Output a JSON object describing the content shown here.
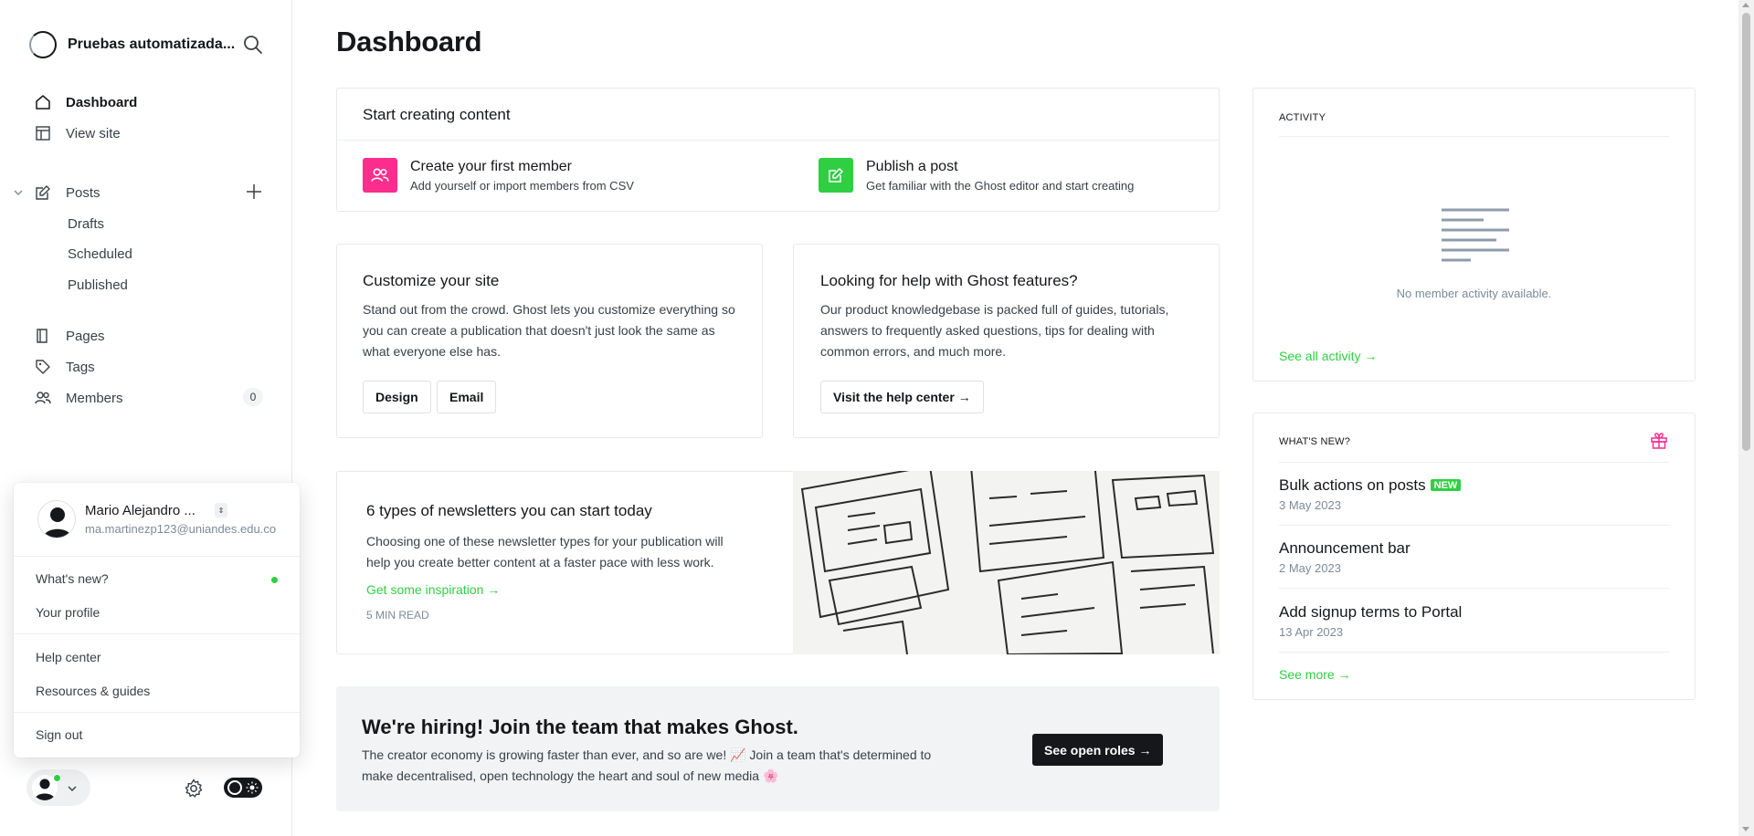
{
  "sidebar": {
    "site_title": "Pruebas automatizada...",
    "nav": {
      "dashboard": "Dashboard",
      "view_site": "View site",
      "posts": "Posts",
      "drafts": "Drafts",
      "scheduled": "Scheduled",
      "published": "Published",
      "pages": "Pages",
      "tags": "Tags",
      "members": "Members",
      "members_count": "0"
    },
    "user_menu": {
      "name": "Mario Alejandro ...",
      "email": "ma.martinezp123@uniandes.edu.co",
      "whats_new": "What's new?",
      "your_profile": "Your profile",
      "help_center": "Help center",
      "resources": "Resources & guides",
      "sign_out": "Sign out"
    }
  },
  "main": {
    "title": "Dashboard",
    "start_creating": {
      "title": "Start creating content",
      "member_title": "Create your first member",
      "member_text": "Add yourself or import members from CSV",
      "post_title": "Publish a post",
      "post_text": "Get familiar with the Ghost editor and start creating"
    },
    "customize": {
      "title": "Customize your site",
      "text": "Stand out from the crowd. Ghost lets you customize everything so you can create a publication that doesn't just look the same as what everyone else has.",
      "design_btn": "Design",
      "email_btn": "Email"
    },
    "help": {
      "title": "Looking for help with Ghost features?",
      "text": "Our product knowledgebase is packed full of guides, tutorials, answers to frequently asked questions, tips for dealing with common errors, and much more.",
      "button": "Visit the help center →"
    },
    "newsletter": {
      "title": "6 types of newsletters you can start today",
      "text": "Choosing one of these newsletter types for your publication will help you create better content at a faster pace with less work.",
      "link": "Get some inspiration →",
      "read_time": "5 MIN READ"
    },
    "hiring": {
      "title": "We're hiring! Join the team that makes Ghost.",
      "text": "The creator economy is growing faster than ever, and so are we! 📈 Join a team that's determined to make decentralised, open technology the heart and soul of new media 🌸",
      "button": "See open roles →"
    }
  },
  "activity": {
    "label": "ACTIVITY",
    "empty": "No member activity available.",
    "link": "See all activity →"
  },
  "whats_new": {
    "label": "WHAT'S NEW?",
    "items": [
      {
        "title": "Bulk actions on posts",
        "date": "3 May 2023",
        "badge": "NEW"
      },
      {
        "title": "Announcement bar",
        "date": "2 May 2023"
      },
      {
        "title": "Add signup terms to Portal",
        "date": "13 Apr 2023"
      }
    ],
    "link": "See more →"
  },
  "colors": {
    "accent_green": "#30cf43",
    "member_pink": "#fb2d8d",
    "text_dark": "#15171a"
  }
}
